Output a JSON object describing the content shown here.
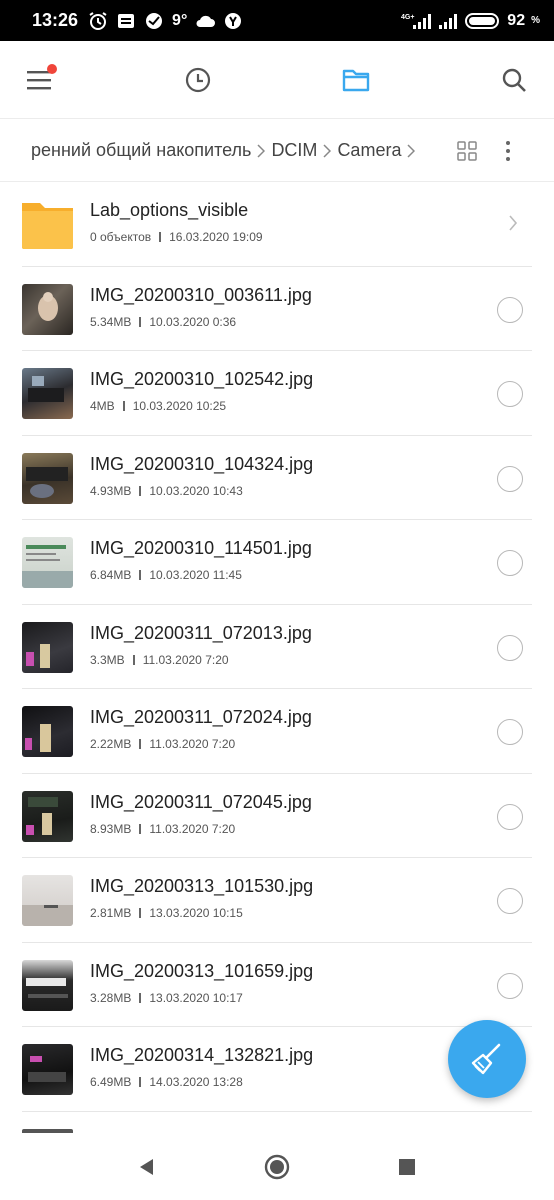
{
  "status_bar": {
    "time": "13:26",
    "temperature": "9°",
    "network_label": "4G+",
    "battery": "92"
  },
  "toolbar": {
    "menu_icon": "menu-icon",
    "recent_icon": "clock-icon",
    "files_icon": "folder-icon",
    "search_icon": "search-icon",
    "active_color": "#3aa8ee"
  },
  "breadcrumb": {
    "items": [
      "ренний общий накопитель",
      "DCIM",
      "Camera"
    ]
  },
  "files": [
    {
      "type": "folder",
      "name": "Lab_options_visible",
      "info": "0 объектов",
      "date": "16.03.2020 19:09"
    },
    {
      "type": "image",
      "name": "IMG_20200310_003611.jpg",
      "info": "5.34MB",
      "date": "10.03.2020 0:36"
    },
    {
      "type": "image",
      "name": "IMG_20200310_102542.jpg",
      "info": "4MB",
      "date": "10.03.2020 10:25"
    },
    {
      "type": "image",
      "name": "IMG_20200310_104324.jpg",
      "info": "4.93MB",
      "date": "10.03.2020 10:43"
    },
    {
      "type": "image",
      "name": "IMG_20200310_114501.jpg",
      "info": "6.84MB",
      "date": "10.03.2020 11:45"
    },
    {
      "type": "image",
      "name": "IMG_20200311_072013.jpg",
      "info": "3.3MB",
      "date": "11.03.2020 7:20"
    },
    {
      "type": "image",
      "name": "IMG_20200311_072024.jpg",
      "info": "2.22MB",
      "date": "11.03.2020 7:20"
    },
    {
      "type": "image",
      "name": "IMG_20200311_072045.jpg",
      "info": "8.93MB",
      "date": "11.03.2020 7:20"
    },
    {
      "type": "image",
      "name": "IMG_20200313_101530.jpg",
      "info": "2.81MB",
      "date": "13.03.2020 10:15"
    },
    {
      "type": "image",
      "name": "IMG_20200313_101659.jpg",
      "info": "3.28MB",
      "date": "13.03.2020 10:17"
    },
    {
      "type": "image",
      "name": "IMG_20200314_132821.jpg",
      "info": "6.49MB",
      "date": "14.03.2020 13:28"
    }
  ],
  "fab": {
    "icon": "broom-icon",
    "color": "#3aa8ee"
  }
}
